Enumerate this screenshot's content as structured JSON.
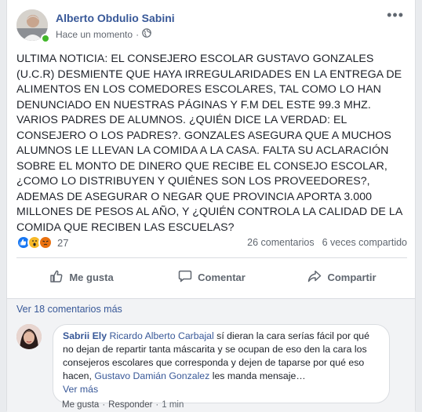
{
  "post": {
    "author": "Alberto Obdulio Sabini",
    "timestamp": "Hace un momento",
    "separator": "·",
    "more_icon": "•••",
    "text": "ULTIMA NOTICIA: EL CONSEJERO ESCOLAR GUSTAVO GONZALES (U.C.R) DESMIENTE QUE HAYA IRREGULARIDADES EN LA ENTREGA DE ALIMENTOS EN LOS COMEDORES ESCOLARES, TAL COMO LO HAN DENUNCIADO EN NUESTRAS PÁGINAS Y F.M DEL ESTE 99.3 MHZ. VARIOS PADRES DE ALUMNOS. ¿QUIÉN DICE LA VERDAD: EL CONSEJERO O LOS PADRES?. GONZALES ASEGURA QUE A MUCHOS ALUMNOS LE LLEVAN LA COMIDA A LA CASA. FALTA SU ACLARACIÓN SOBRE EL MONTO DE DINERO QUE RECIBE EL CONSEJO ESCOLAR, ¿COMO LO DISTRIBUYEN Y QUIÉNES SON LOS PROVEEDORES?, ADEMAS DE ASEGURAR O NEGAR QUE PROVINCIA APORTA 3.000 MILLONES DE PESOS AL AÑO, Y ¿QUIÉN CONTROLA LA CALIDAD DE LA COMIDA QUE RECIBEN LAS ESCUELAS?"
  },
  "stats": {
    "reaction_count": "27",
    "comments": "26 comentarios",
    "shares": "6 veces compartido"
  },
  "actions": {
    "like": "Me gusta",
    "comment": "Comentar",
    "share": "Compartir"
  },
  "comments": {
    "view_more": "Ver 18 comentarios más",
    "first": {
      "author": "Sabrii Ely",
      "mention1": "Ricardo Alberto Carbajal",
      "text1": " sí dieran la cara serías fácil por qué no dejan de repartir tanta máscarita y se ocupan de eso den la cara los consejeros escolares que corresponda y dejen de taparse por qué eso hacen, ",
      "mention2": "Gustavo Damián Gonzalez",
      "text2": " les manda mensaje…",
      "see_more": "Ver más",
      "like": "Me gusta",
      "reply": "Responder",
      "dot": "·",
      "time": "1 min"
    }
  },
  "colors": {
    "link": "#385898",
    "like_reaction": "#1877f2",
    "wow_reaction": "#f7b928",
    "angry_reaction": "#e9710f",
    "online": "#42b72a"
  }
}
